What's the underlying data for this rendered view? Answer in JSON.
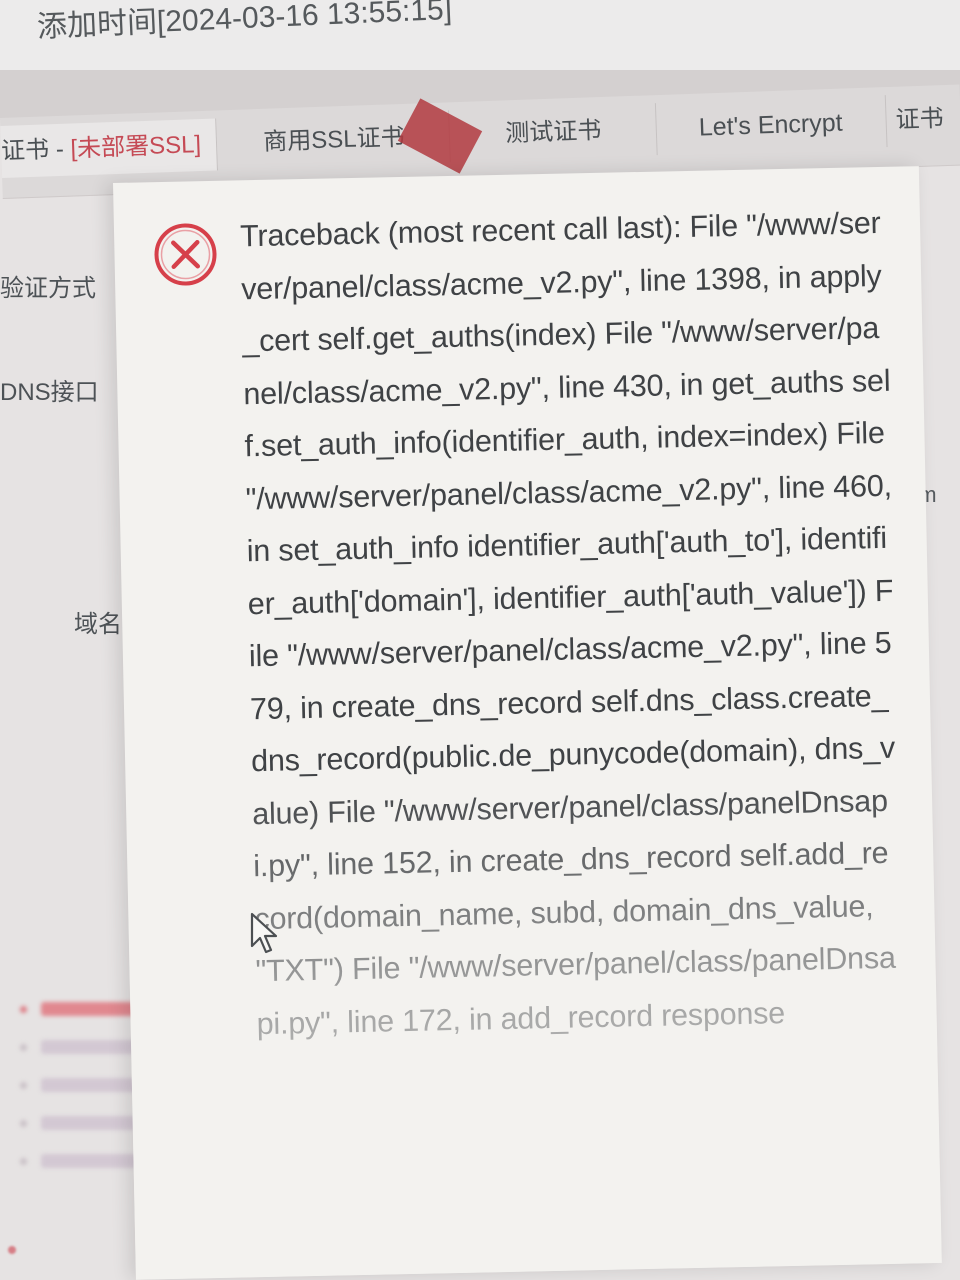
{
  "header": {
    "added_time": "添加时间[2024-03-16 13:55:15]"
  },
  "tabs": [
    {
      "id": "current",
      "label_prefix": "证书 - ",
      "label_status": "[未部署SSL]"
    },
    {
      "id": "commercial",
      "label": "商用SSL证书"
    },
    {
      "id": "test",
      "label": "测试证书"
    },
    {
      "id": "letsencrypt",
      "label": "Let's Encrypt"
    },
    {
      "id": "more",
      "label": "证书"
    }
  ],
  "form": {
    "verify_method_label": "验证方式",
    "dns_api_label": "DNS接口",
    "domain_label": "域名",
    "right_fragment": "om"
  },
  "error_dialog": {
    "icon": "error-circle-x-icon",
    "message": "Traceback (most recent call last): File \"/www/server/panel/class/acme_v2.py\", line 1398, in apply_cert self.get_auths(index) File \"/www/server/panel/class/acme_v2.py\", line 430, in get_auths self.set_auth_info(identifier_auth, index=index) File \"/www/server/panel/class/acme_v2.py\", line 460, in set_auth_info identifier_auth['auth_to'], identifier_auth['domain'], identifier_auth['auth_value']) File \"/www/server/panel/class/acme_v2.py\", line 579, in create_dns_record self.dns_class.create_dns_record(public.de_punycode(domain), dns_value) File \"/www/server/panel/class/panelDnsapi.py\", line 152, in create_dns_record self.add_record(domain_name, subd, domain_dns_value, \"TXT\") File \"/www/server/panel/class/panelDnsapi.py\", line 172, in add_record response"
  },
  "colors": {
    "accent_red": "#c54a55",
    "icon_red": "#d6404a",
    "dialog_bg": "#f3f2ef",
    "text": "#3f4245"
  }
}
